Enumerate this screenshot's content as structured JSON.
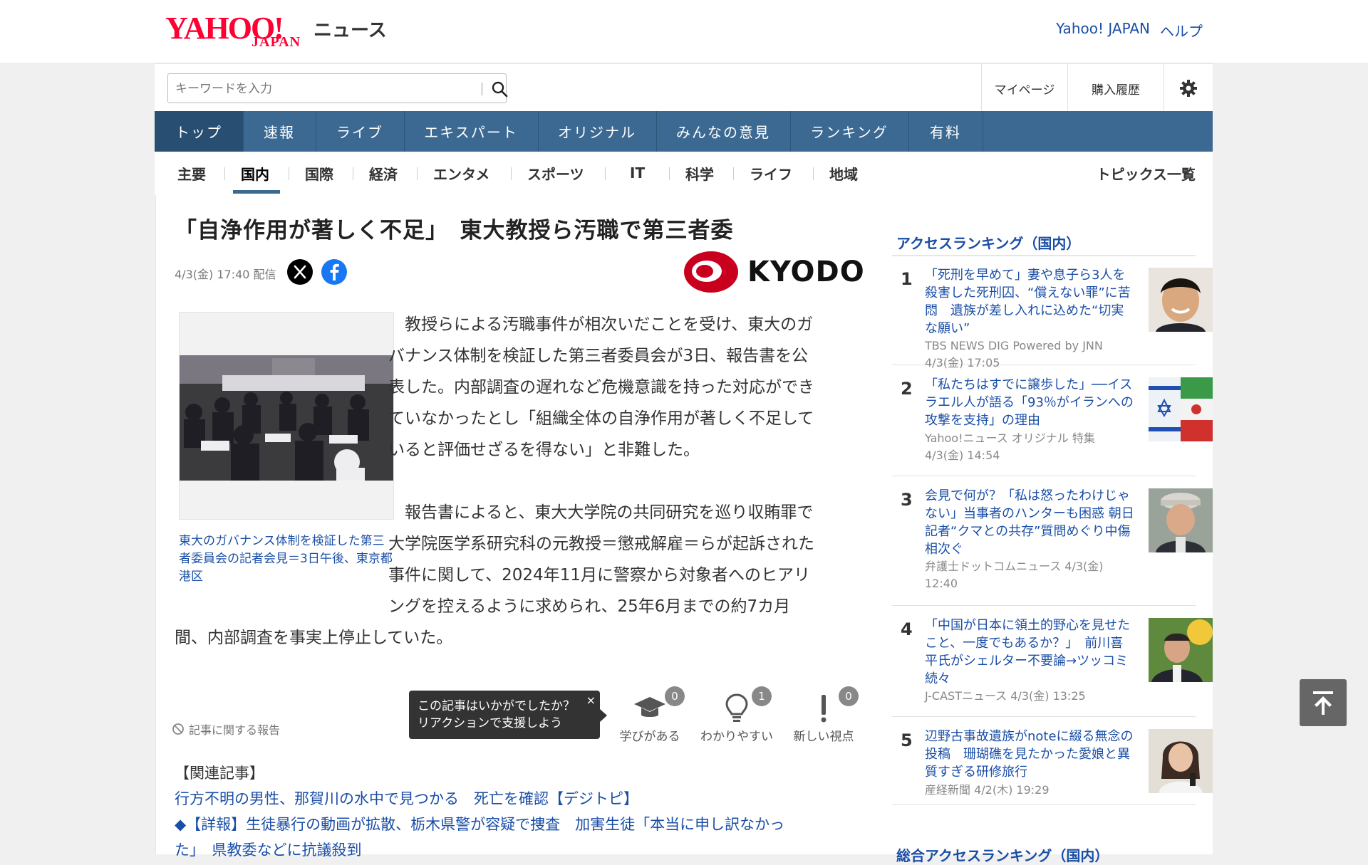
{
  "header": {
    "logo_main": "YAHOO!",
    "logo_sub": "JAPAN",
    "logo_news": "ニュース",
    "links": [
      "Yahoo! JAPAN",
      "ヘルプ"
    ]
  },
  "search": {
    "placeholder": "キーワードを入力"
  },
  "account": {
    "mypage": "マイページ",
    "history": "購入履歴"
  },
  "nav": {
    "tabs": [
      "トップ",
      "速報",
      "ライブ",
      "エキスパート",
      "オリジナル",
      "みんなの意見",
      "ランキング",
      "有料"
    ],
    "active": "トップ"
  },
  "subnav": {
    "items": [
      "主要",
      "国内",
      "国際",
      "経済",
      "エンタメ",
      "スポーツ",
      "IT",
      "科学",
      "ライフ",
      "地域"
    ],
    "active": "国内",
    "topic_list": "トピックス一覧"
  },
  "article": {
    "headline": "「自浄作用が著しく不足」　東大教授ら汚職で第三者委",
    "meta": "4/3(金) 17:40 配信",
    "publisher": "KYODO",
    "photo_caption": "東大のガバナンス体制を検証した第三者委員会の記者会見＝3日午後、東京都港区",
    "para1": [
      "　教授らによる汚職事件が相次いだことを受け、東大のガ",
      "バナンス体制を検証した第三者委員会が3日、報告書を公",
      "表した。内部調査の遅れなど危機意識を持った対応ができ",
      "ていなかったとし「組織全体の自浄作用が著しく不足して",
      "いると評価せざるを得ない」と非難した。"
    ],
    "para2": [
      "　報告書によると、東大大学院の共同研究を巡り収賄罪で",
      "大学院医学系研究科の元教授＝懲戒解雇＝らが起訴された",
      "事件に関して、2024年11月に警察から対象者へのヒアリ",
      "ングを控えるように求められ、25年6月までの約7カ月",
      "間、内部調査を事実上停止していた。"
    ],
    "report_label": "記事に関する報告",
    "tooltip": [
      "この記事はいかがでしたか？",
      "リアクションで支援しよう"
    ],
    "tooltip_close": "×",
    "reactions": [
      {
        "label": "学びがある",
        "count": "0"
      },
      {
        "label": "わかりやすい",
        "count": "1"
      },
      {
        "label": "新しい視点",
        "count": "0"
      }
    ],
    "related_title": "【関連記事】",
    "related": [
      "行方不明の男性、那賀川の水中で見つかる　死亡を確認【デジトピ】",
      "◆【詳報】生徒暴行の動画が拡散、栃木県警が容疑で捜査　加害生徒「本当に申し訳なかっ",
      "た」　県教委などに抗議殺到"
    ]
  },
  "sidebar": {
    "title": "アクセスランキング（国内）",
    "rankings": [
      {
        "num": "1",
        "title": "「死刑を早めて」妻や息子ら3人を殺害した死刑囚、“償えない罪”に苦悶　遺族が差し入れに込めた“切実な願い”",
        "source": "TBS NEWS DIG Powered by JNN",
        "time": "4/3(金) 17:05"
      },
      {
        "num": "2",
        "title": "「私たちはすでに譲歩した」──イスラエル人が語る「93％がイランへの攻撃を支持」の理由",
        "source": "Yahoo!ニュース オリジナル 特集",
        "time": "4/3(金) 14:54"
      },
      {
        "num": "3",
        "title": "会見で何が？「私は怒ったわけじゃない」当事者のハンターも困惑 朝日記者“クマとの共存”質問めぐり中傷相次ぐ",
        "source": "弁護士ドットコムニュース 4/3(金)",
        "time": "12:40"
      },
      {
        "num": "4",
        "title": "「中国が日本に領土的野心を見せたこと、一度でもあるか？」　前川喜平氏がシェルター不要論→ツッコミ続々",
        "source": "J-CASTニュース 4/3(金) 13:25",
        "time": ""
      },
      {
        "num": "5",
        "title": "辺野古事故遺族がnoteに綴る無念の投稿　珊瑚礁を見たかった愛娘と異質すぎる研修旅行",
        "source": "産経新聞 4/2(木) 19:29",
        "time": ""
      }
    ],
    "title2": "総合アクセスランキング（国内）"
  }
}
